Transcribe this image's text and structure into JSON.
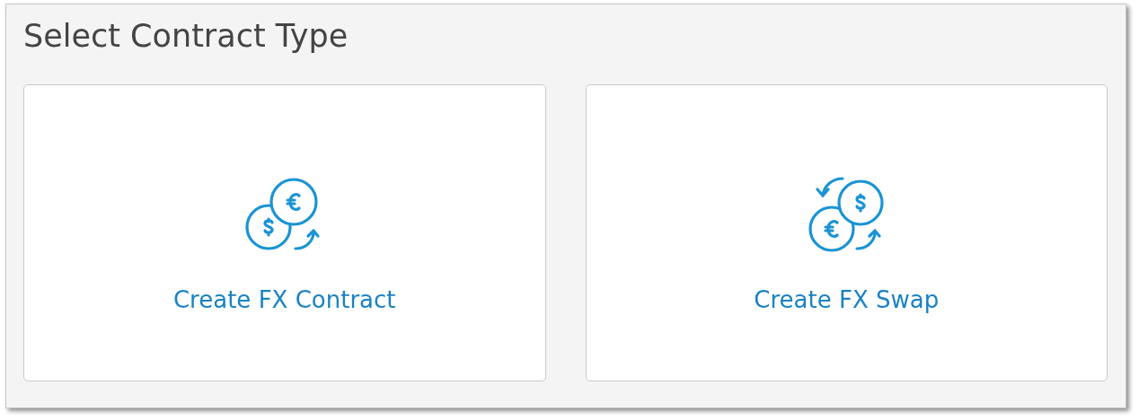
{
  "title": "Select Contract Type",
  "options": [
    {
      "kind": "contract",
      "label": "Create FX Contract"
    },
    {
      "kind": "swap",
      "label": "Create FX Swap"
    }
  ]
}
